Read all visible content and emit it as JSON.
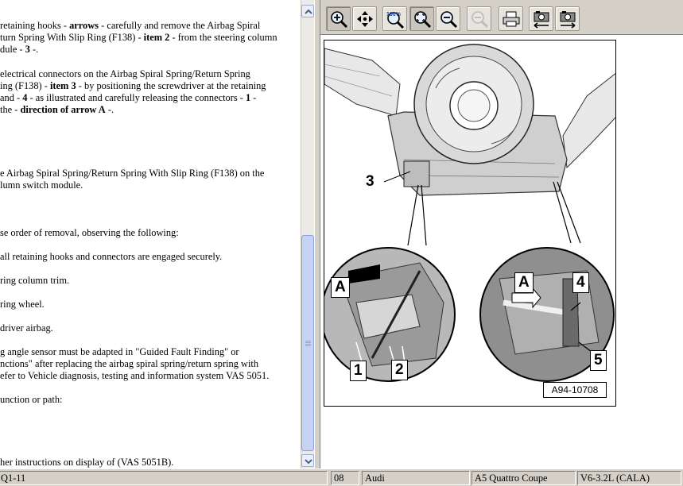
{
  "text_lines": [
    {
      "pre": "retaining hooks - ",
      "bold": "arrows",
      "post": " - carefully and remove the Airbag Spiral"
    },
    {
      "pre": "turn Spring With Slip Ring (F138) - ",
      "bold": "item 2",
      "post": " - from the steering column"
    },
    {
      "pre": "dule - ",
      "bold": "3",
      "post": " -."
    },
    {
      "pre": "electrical connectors on the Airbag Spiral Spring/Return Spring",
      "bold": "",
      "post": ""
    },
    {
      "pre": "ing (F138) - ",
      "bold": "item 3",
      "post": " - by positioning the screwdriver at the retaining"
    },
    {
      "pre": "and - ",
      "bold": "4",
      "post": " - as illustrated and carefully releasing the connectors - "
    },
    {
      "pre": "the - ",
      "bold": "direction of arrow A",
      "post": " -."
    },
    {
      "pre": "e Airbag Spiral Spring/Return Spring With Slip Ring (F138) on the",
      "bold": "",
      "post": ""
    },
    {
      "pre": "lumn switch module.",
      "bold": "",
      "post": ""
    },
    {
      "pre": "se order of removal, observing the following:",
      "bold": "",
      "post": ""
    },
    {
      "pre": "all retaining hooks and connectors are engaged securely.",
      "bold": "",
      "post": ""
    },
    {
      "pre": "ring column trim.",
      "bold": "",
      "post": ""
    },
    {
      "pre": "ring wheel.",
      "bold": "",
      "post": ""
    },
    {
      "pre": "driver airbag.",
      "bold": "",
      "post": ""
    },
    {
      "pre": "g angle sensor must be adapted in \"Guided Fault Finding\" or",
      "bold": "",
      "post": ""
    },
    {
      "pre": "nctions\" after replacing the airbag spiral spring/return spring with",
      "bold": "",
      "post": ""
    },
    {
      "pre": "efer to Vehicle diagnosis, testing and information system VAS 5051.",
      "bold": "",
      "post": ""
    },
    {
      "pre": "unction or path:",
      "bold": "",
      "post": ""
    },
    {
      "pre": "her instructions on display of (VAS 5051B).",
      "bold": "",
      "post": ""
    }
  ],
  "line5_tail_bold": "1",
  "line5_tail_post": " -",
  "toolbar": {
    "buttons": [
      {
        "name": "zoom-in-button",
        "icon": "zoom-in-icon"
      },
      {
        "name": "pan-button",
        "icon": "move-arrows-icon"
      },
      {
        "name": "zoom-100-button",
        "icon": "zoom-100-icon",
        "label": "100%"
      },
      {
        "name": "zoom-fit-button",
        "icon": "zoom-fit-icon"
      },
      {
        "name": "zoom-out-button",
        "icon": "zoom-out-icon"
      },
      {
        "name": "zoom-disabled-button",
        "icon": "zoom-gray-icon"
      },
      {
        "name": "print-button",
        "icon": "printer-icon"
      },
      {
        "name": "previous-image-button",
        "icon": "camera-left-icon"
      },
      {
        "name": "next-image-button",
        "icon": "camera-right-icon"
      }
    ]
  },
  "figure": {
    "callouts": {
      "c1": "1",
      "c2": "2",
      "c3": "3",
      "c4": "4",
      "c5": "5",
      "a_left": "A",
      "a_right": "A"
    },
    "reference": "A94-10708"
  },
  "statusbar": {
    "cell1": "Q1-11",
    "cell2": "08",
    "cell3": "Audi",
    "cell4": "A5 Quattro Coupe",
    "cell5": "V6-3.2L (CALA)"
  },
  "colors": {
    "scroll_thumb": "#c6d3f5",
    "toolbar_bg": "#d4d0c8"
  }
}
